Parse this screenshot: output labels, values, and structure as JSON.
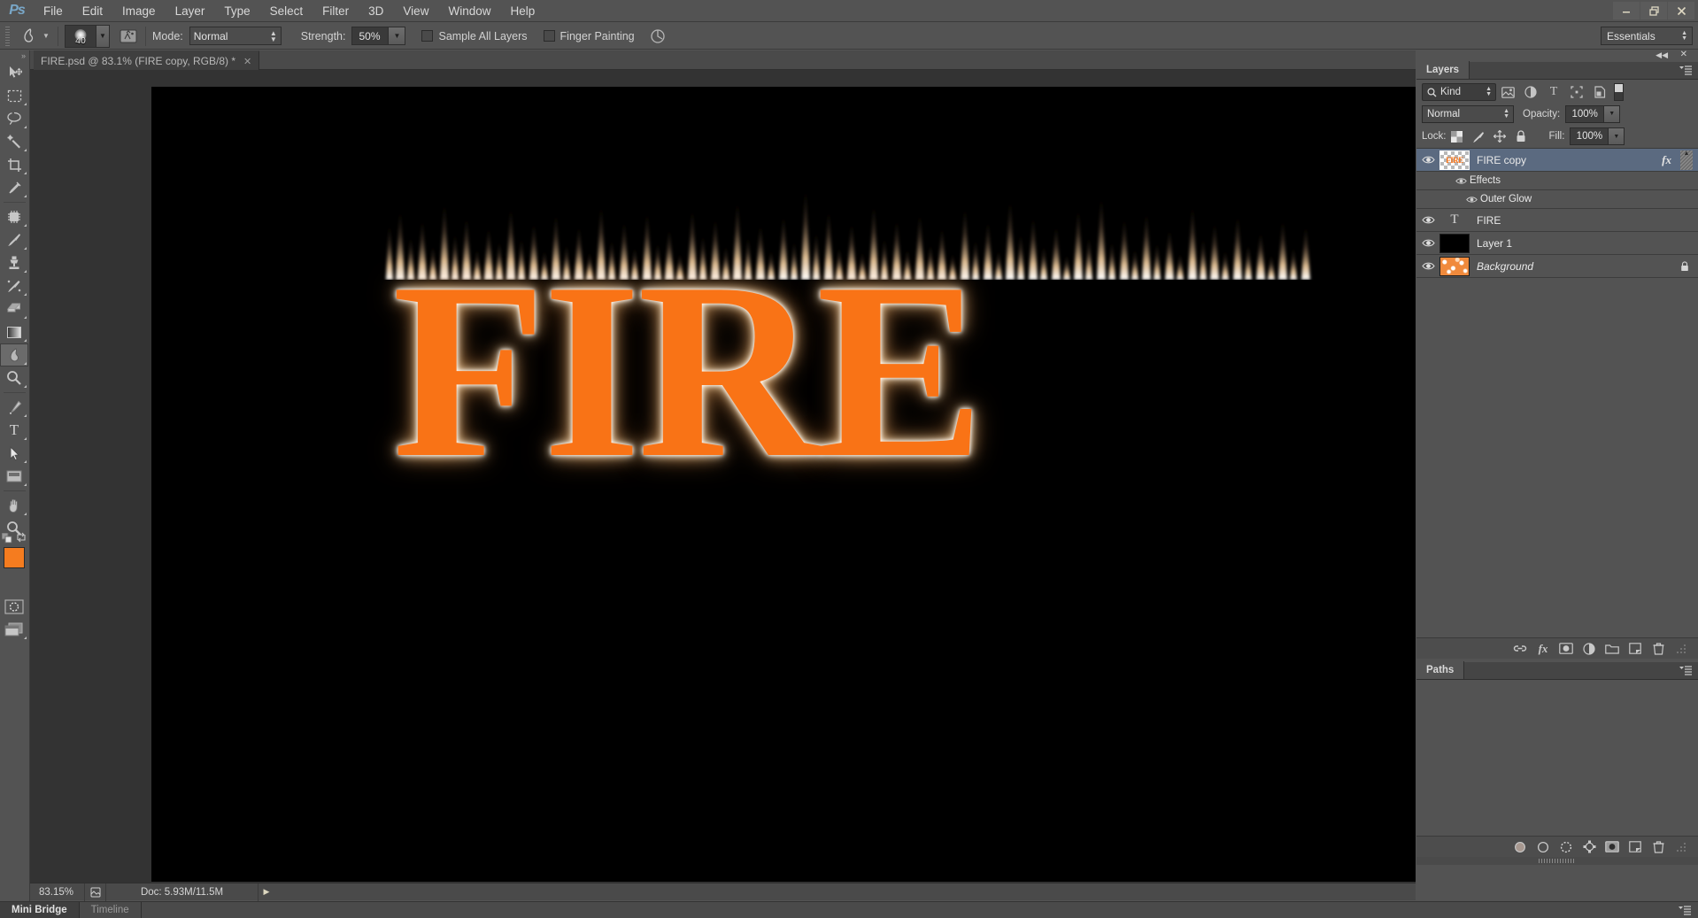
{
  "app": {
    "logo": "Ps",
    "menu": [
      "File",
      "Edit",
      "Image",
      "Layer",
      "Type",
      "Select",
      "Filter",
      "3D",
      "View",
      "Window",
      "Help"
    ],
    "window_controls": {
      "minimize": "–",
      "restore": "❐",
      "close": "✕"
    }
  },
  "options_bar": {
    "tool_icon": "smudge-tool",
    "brush_size": "40",
    "brush_panel_icon": "brush-panel-toggle",
    "mode_label": "Mode:",
    "mode_value": "Normal",
    "strength_label": "Strength:",
    "strength_value": "50%",
    "sample_all_layers_label": "Sample All Layers",
    "sample_all_layers_checked": false,
    "finger_painting_label": "Finger Painting",
    "finger_painting_checked": false,
    "pressure_icon": "tablet-pressure-icon",
    "workspace": "Essentials"
  },
  "toolbar": {
    "tools": [
      {
        "name": "move-tool",
        "glyph": "move",
        "has_submenu": false
      },
      {
        "name": "rectangular-marquee-tool",
        "glyph": "marquee",
        "has_submenu": true
      },
      {
        "name": "lasso-tool",
        "glyph": "lasso",
        "has_submenu": true
      },
      {
        "name": "quick-selection-tool",
        "glyph": "magicwand",
        "has_submenu": true
      },
      {
        "name": "crop-tool",
        "glyph": "crop",
        "has_submenu": true
      },
      {
        "name": "eyedropper-tool",
        "glyph": "eyedropper",
        "has_submenu": true
      },
      {
        "name": "spot-healing-brush-tool",
        "glyph": "healing",
        "has_submenu": true
      },
      {
        "name": "brush-tool",
        "glyph": "brush",
        "has_submenu": true
      },
      {
        "name": "clone-stamp-tool",
        "glyph": "stamp",
        "has_submenu": true
      },
      {
        "name": "history-brush-tool",
        "glyph": "historybrush",
        "has_submenu": true
      },
      {
        "name": "eraser-tool",
        "glyph": "eraser",
        "has_submenu": true
      },
      {
        "name": "gradient-tool",
        "glyph": "gradient",
        "has_submenu": true
      },
      {
        "name": "smudge-tool",
        "glyph": "smudge",
        "has_submenu": true,
        "active": true
      },
      {
        "name": "dodge-tool",
        "glyph": "dodge",
        "has_submenu": true
      },
      {
        "name": "pen-tool",
        "glyph": "pen",
        "has_submenu": true
      },
      {
        "name": "horizontal-type-tool",
        "glyph": "type",
        "has_submenu": true
      },
      {
        "name": "path-selection-tool",
        "glyph": "pathselect",
        "has_submenu": true
      },
      {
        "name": "rectangle-tool",
        "glyph": "shape",
        "has_submenu": true
      },
      {
        "name": "hand-tool",
        "glyph": "hand",
        "has_submenu": true
      },
      {
        "name": "zoom-tool",
        "glyph": "zoom",
        "has_submenu": false
      }
    ],
    "foreground_color": "#f57c1f",
    "background_color": "#ffffff",
    "quick_mask_icon": "quick-mask-mode",
    "screen_mode_icon": "screen-mode"
  },
  "document": {
    "tab_title": "FIRE.psd @ 83.1% (FIRE copy, RGB/8) *",
    "close_glyph": "✕",
    "canvas_text": "FIRE",
    "canvas_background": "#000000",
    "text_color": "#f97316",
    "glow_color": "#ffffff"
  },
  "status_bar": {
    "zoom": "83.15%",
    "preview_icon": "document-preview-icon",
    "doc_info": "Doc: 5.93M/11.5M",
    "expand_glyph": "▶"
  },
  "bottom_dock": {
    "tabs": [
      {
        "label": "Mini Bridge",
        "active": true
      },
      {
        "label": "Timeline",
        "active": false
      }
    ],
    "menu_icon": "panel-menu-icon"
  },
  "layers_panel": {
    "tab_label": "Layers",
    "menu_icon": "panel-menu-icon",
    "filter": {
      "kind_label": "Kind",
      "search_icon": "search-icon",
      "icons": [
        "pixel-layers-filter",
        "adjustment-layers-filter",
        "type-layers-filter",
        "shape-layers-filter",
        "smart-object-filter"
      ],
      "toggle_icon": "filter-enable-toggle"
    },
    "blend_mode": "Normal",
    "opacity_label": "Opacity:",
    "opacity_value": "100%",
    "lock_label": "Lock:",
    "lock_icons": [
      "lock-transparent-pixels",
      "lock-image-pixels",
      "lock-position",
      "lock-all"
    ],
    "fill_label": "Fill:",
    "fill_value": "100%",
    "rows": [
      {
        "type": "layer",
        "name": "FIRE copy",
        "visible": true,
        "selected": true,
        "thumb": "checker-fire",
        "has_fx": true,
        "fx_glyph": "fx",
        "italic": false,
        "locked": false
      },
      {
        "type": "effects-group",
        "name": "Effects",
        "visible": true,
        "indent": 1
      },
      {
        "type": "effect",
        "name": "Outer Glow",
        "visible": true,
        "indent": 2
      },
      {
        "type": "layer",
        "name": "FIRE",
        "visible": true,
        "selected": false,
        "thumb": "type",
        "has_fx": false,
        "italic": false,
        "locked": false
      },
      {
        "type": "layer",
        "name": "Layer 1",
        "visible": true,
        "selected": false,
        "thumb": "black",
        "has_fx": false,
        "italic": false,
        "locked": false
      },
      {
        "type": "layer",
        "name": "Background",
        "visible": true,
        "selected": false,
        "thumb": "background-texture",
        "has_fx": false,
        "italic": true,
        "locked": true,
        "lock_glyph": "🔒"
      }
    ],
    "footer_icons": [
      "link-layers-icon",
      "add-layer-style-icon",
      "add-layer-mask-icon",
      "new-adjustment-layer-icon",
      "new-group-icon",
      "new-layer-icon",
      "delete-layer-icon"
    ]
  },
  "paths_panel": {
    "tab_label": "Paths",
    "menu_icon": "panel-menu-icon",
    "footer_icons": [
      "fill-path-icon",
      "stroke-path-icon",
      "load-path-as-selection-icon",
      "make-work-path-icon",
      "add-layer-mask-icon",
      "new-path-icon",
      "delete-path-icon"
    ]
  },
  "dock_controls": {
    "collapse_glyph": "◀◀",
    "close_glyph": "✕"
  }
}
